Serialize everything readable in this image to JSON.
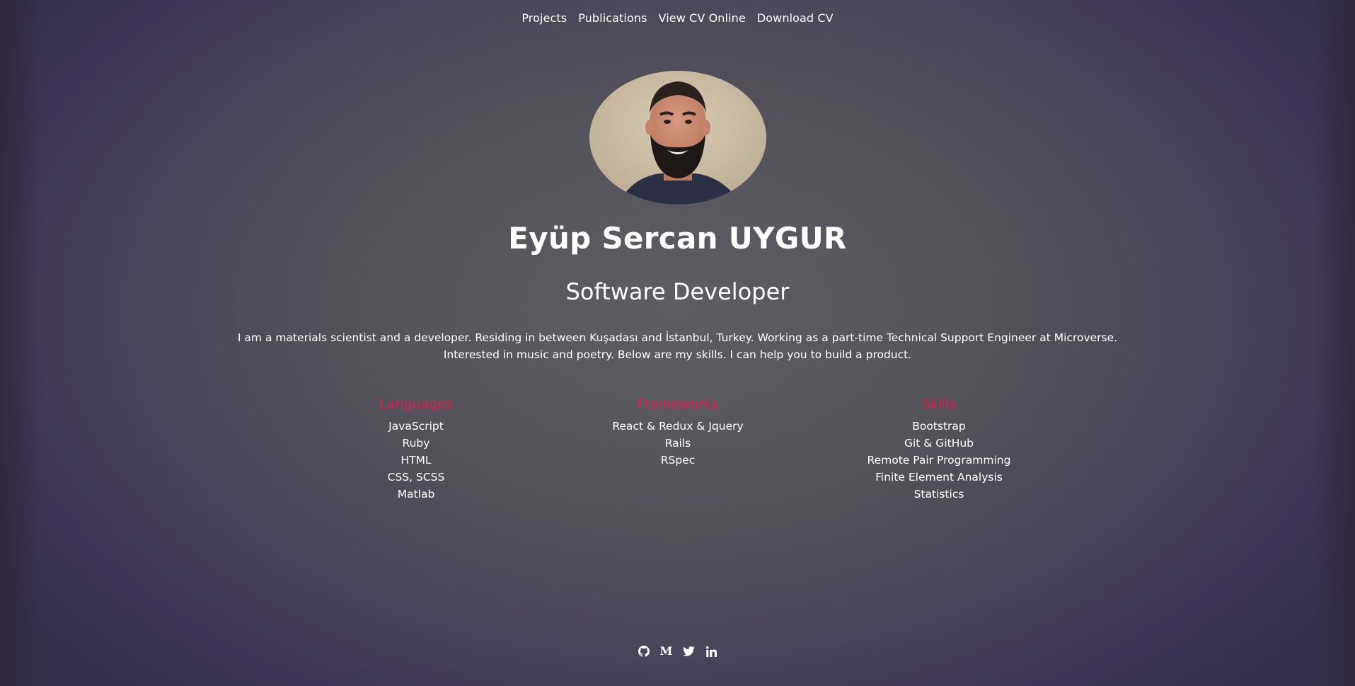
{
  "nav": {
    "items": [
      {
        "label": "Projects"
      },
      {
        "label": "Publications"
      },
      {
        "label": "View CV Online"
      },
      {
        "label": "Download CV"
      }
    ]
  },
  "profile": {
    "name": "Eyüp Sercan UYGUR",
    "title": "Software Developer",
    "bio_line1": "I am a materials scientist and a developer. Residing in between Kuşadası and İstanbul, Turkey. Working as a part-time Technical Support Engineer at Microverse.",
    "bio_line2": "Interested in music and poetry. Below are my skills. I can help you to build a product."
  },
  "skills": {
    "languages": {
      "heading": "Languages",
      "items": [
        "JavaScript",
        "Ruby",
        "HTML",
        "CSS, SCSS",
        "Matlab"
      ]
    },
    "frameworks": {
      "heading": "Frameworks",
      "items": [
        "React & Redux & Jquery",
        "Rails",
        "RSpec"
      ]
    },
    "skills": {
      "heading": "Skills",
      "items": [
        "Bootstrap",
        "Git & GitHub",
        "Remote Pair Programming",
        "Finite Element Analysis",
        "Statistics"
      ]
    }
  },
  "social": {
    "icons": [
      "github-icon",
      "medium-icon",
      "twitter-icon",
      "linkedin-icon"
    ],
    "medium_glyph": "M"
  },
  "colors": {
    "heading_accent": "#e01e4e",
    "text": "#ffffff"
  }
}
